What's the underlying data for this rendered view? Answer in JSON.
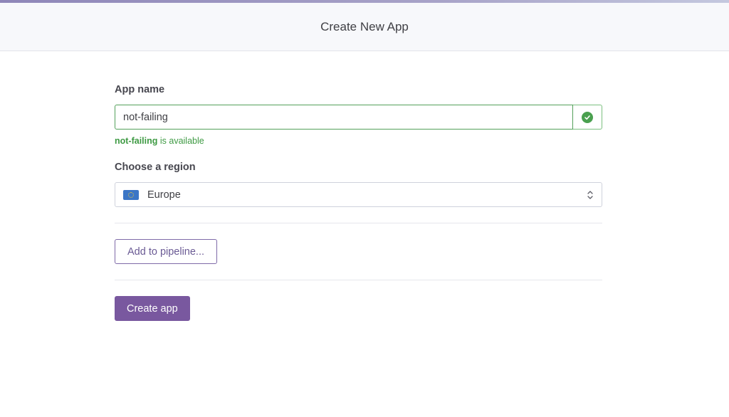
{
  "header": {
    "title": "Create New App"
  },
  "form": {
    "app_name_label": "App name",
    "app_name_value": "not-failing",
    "availability": {
      "name": "not-failing",
      "message": " is available"
    },
    "region_label": "Choose a region",
    "region_value": "Europe",
    "region_icon": "eu-flag-icon",
    "pipeline_button": "Add to pipeline...",
    "create_button": "Create app"
  },
  "colors": {
    "accent": "#79589f",
    "success": "#3e9a43"
  }
}
